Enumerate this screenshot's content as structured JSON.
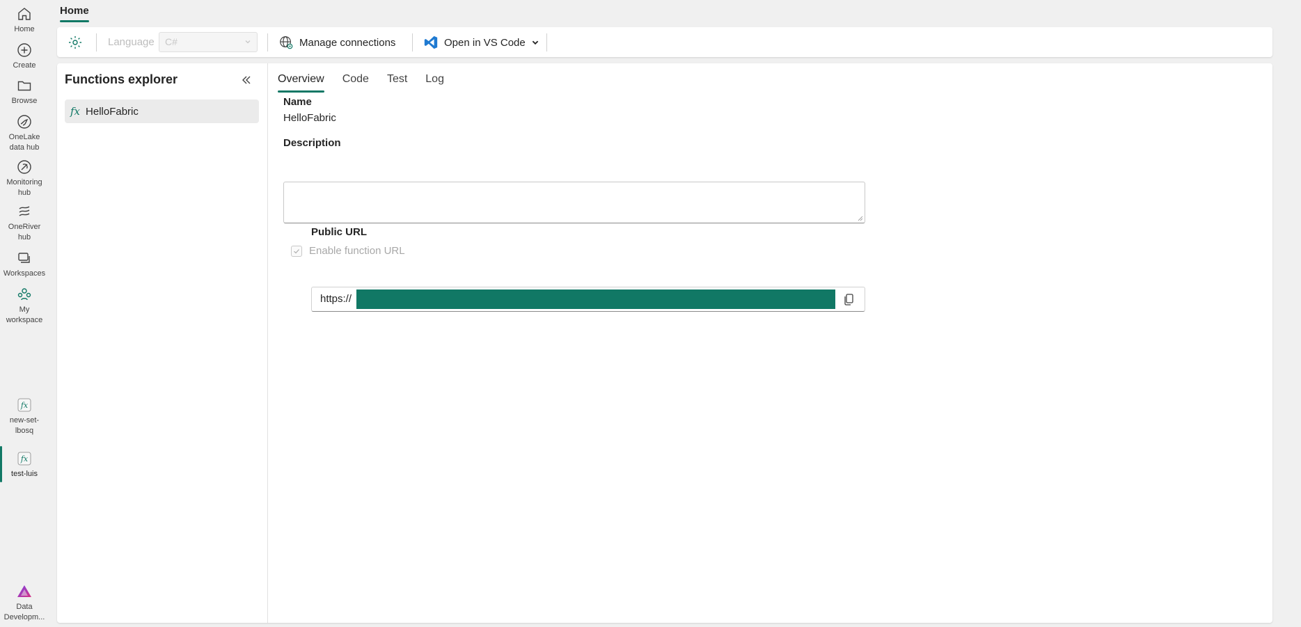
{
  "nav": {
    "items": [
      {
        "label": "Home",
        "icon": "home-icon"
      },
      {
        "label": "Create",
        "icon": "plus-circle-icon"
      },
      {
        "label": "Browse",
        "icon": "folder-icon"
      },
      {
        "label": "OneLake data hub",
        "icon": "onelake-icon"
      },
      {
        "label": "Monitoring hub",
        "icon": "monitor-icon"
      },
      {
        "label": "OneRiver hub",
        "icon": "river-icon"
      },
      {
        "label": "Workspaces",
        "icon": "workspaces-icon"
      },
      {
        "label": "My workspace",
        "icon": "people-icon"
      },
      {
        "label": "new-set-lbosq",
        "icon": "fx-icon"
      },
      {
        "label": "test-luis",
        "icon": "fx-icon"
      }
    ],
    "footer_label": "Data Developm...",
    "accent": "#117865"
  },
  "header": {
    "tab": "Home"
  },
  "toolbar": {
    "language_label": "Language",
    "language_value": "C#",
    "manage_connections": "Manage connections",
    "open_vscode": "Open in VS Code"
  },
  "explorer": {
    "title": "Functions explorer",
    "items": [
      {
        "icon_text": "fx",
        "label": "HelloFabric"
      }
    ]
  },
  "content": {
    "tabs": [
      "Overview",
      "Code",
      "Test",
      "Log"
    ],
    "active_tab": "Overview",
    "name_label": "Name",
    "name_value": "HelloFabric",
    "description_label": "Description",
    "description_value": "",
    "enable_url_label": "Enable function URL",
    "public_url_label": "Public URL",
    "public_url_prefix": "https://"
  }
}
